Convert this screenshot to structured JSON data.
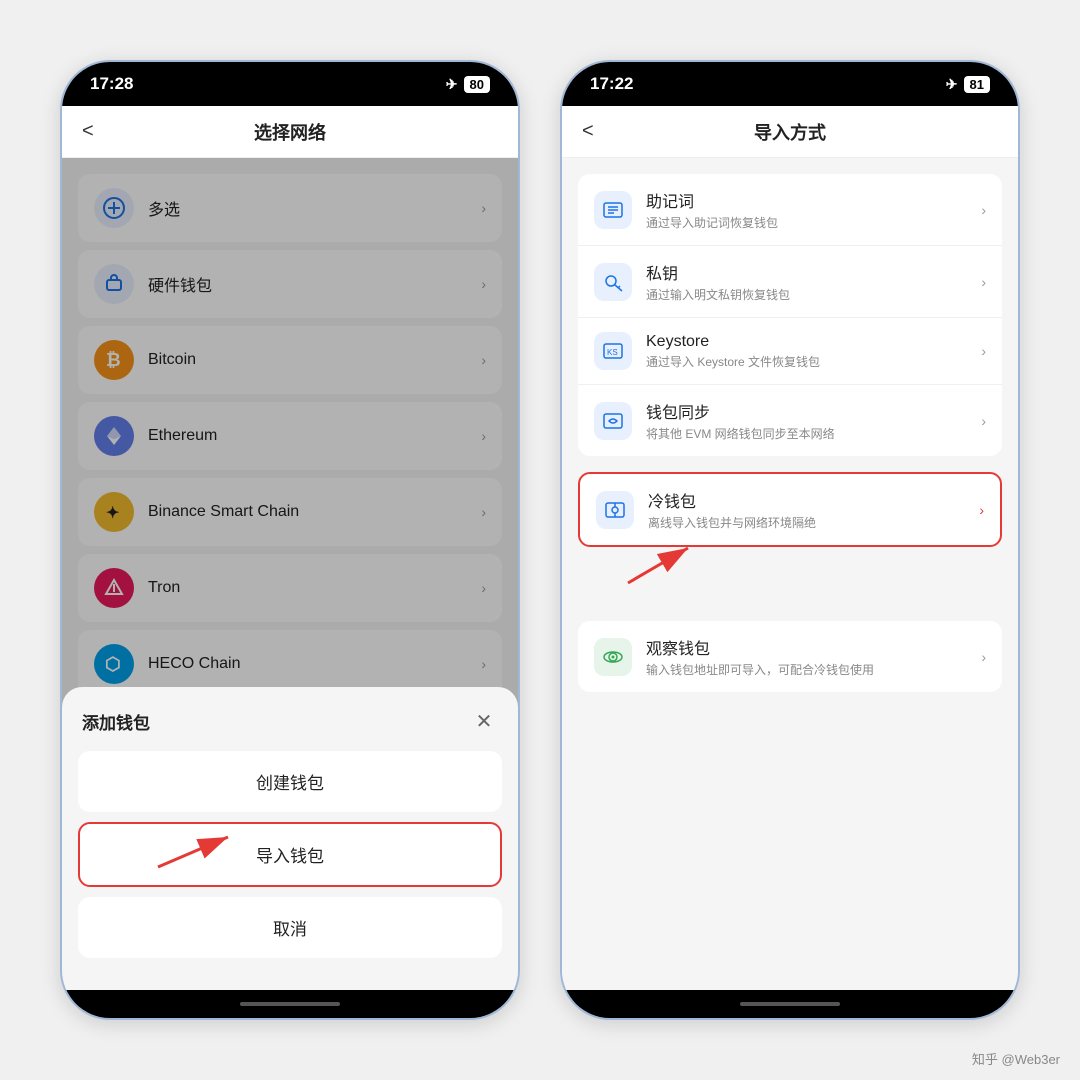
{
  "left_phone": {
    "status": {
      "time": "17:28",
      "battery": "80"
    },
    "header": {
      "back": "<",
      "title": "选择网络"
    },
    "networks": [
      {
        "id": "multiselect",
        "name": "多选",
        "icon_type": "multiselect",
        "icon_text": "⊕"
      },
      {
        "id": "hardware",
        "name": "硬件钱包",
        "icon_type": "hardware",
        "icon_text": "🔒"
      },
      {
        "id": "bitcoin",
        "name": "Bitcoin",
        "icon_type": "bitcoin",
        "icon_text": "₿"
      },
      {
        "id": "ethereum",
        "name": "Ethereum",
        "icon_type": "ethereum",
        "icon_text": "◈"
      },
      {
        "id": "bsc",
        "name": "Binance Smart Chain",
        "icon_type": "bsc",
        "icon_text": "✦"
      },
      {
        "id": "tron",
        "name": "Tron",
        "icon_type": "tron",
        "icon_text": "◉"
      },
      {
        "id": "heco",
        "name": "HECO Chain",
        "icon_type": "heco",
        "icon_text": "⬡"
      }
    ],
    "modal": {
      "title": "添加钱包",
      "create_label": "创建钱包",
      "import_label": "导入钱包",
      "cancel_label": "取消"
    }
  },
  "right_phone": {
    "status": {
      "time": "17:22",
      "battery": "81"
    },
    "header": {
      "back": "<",
      "title": "导入方式"
    },
    "import_groups": [
      {
        "items": [
          {
            "id": "mnemonic",
            "name": "助记词",
            "desc": "通过导入助记词恢复钱包",
            "icon_type": "blue"
          },
          {
            "id": "privatekey",
            "name": "私钥",
            "desc": "通过输入明文私钥恢复钱包",
            "icon_type": "blue"
          },
          {
            "id": "keystore",
            "name": "Keystore",
            "desc": "通过导入 Keystore 文件恢复钱包",
            "icon_type": "blue"
          },
          {
            "id": "walletsync",
            "name": "钱包同步",
            "desc": "将其他 EVM 网络钱包同步至本网络",
            "icon_type": "blue"
          }
        ]
      },
      {
        "items": [
          {
            "id": "coldwallet",
            "name": "冷钱包",
            "desc": "离线导入钱包并与网络环境隔绝",
            "icon_type": "blue",
            "highlighted": true
          }
        ]
      },
      {
        "items": [
          {
            "id": "observewallet",
            "name": "观察钱包",
            "desc": "输入钱包地址即可导入，可配合冷钱包使用",
            "icon_type": "green"
          }
        ]
      }
    ]
  },
  "watermark": "知乎 @Web3er"
}
